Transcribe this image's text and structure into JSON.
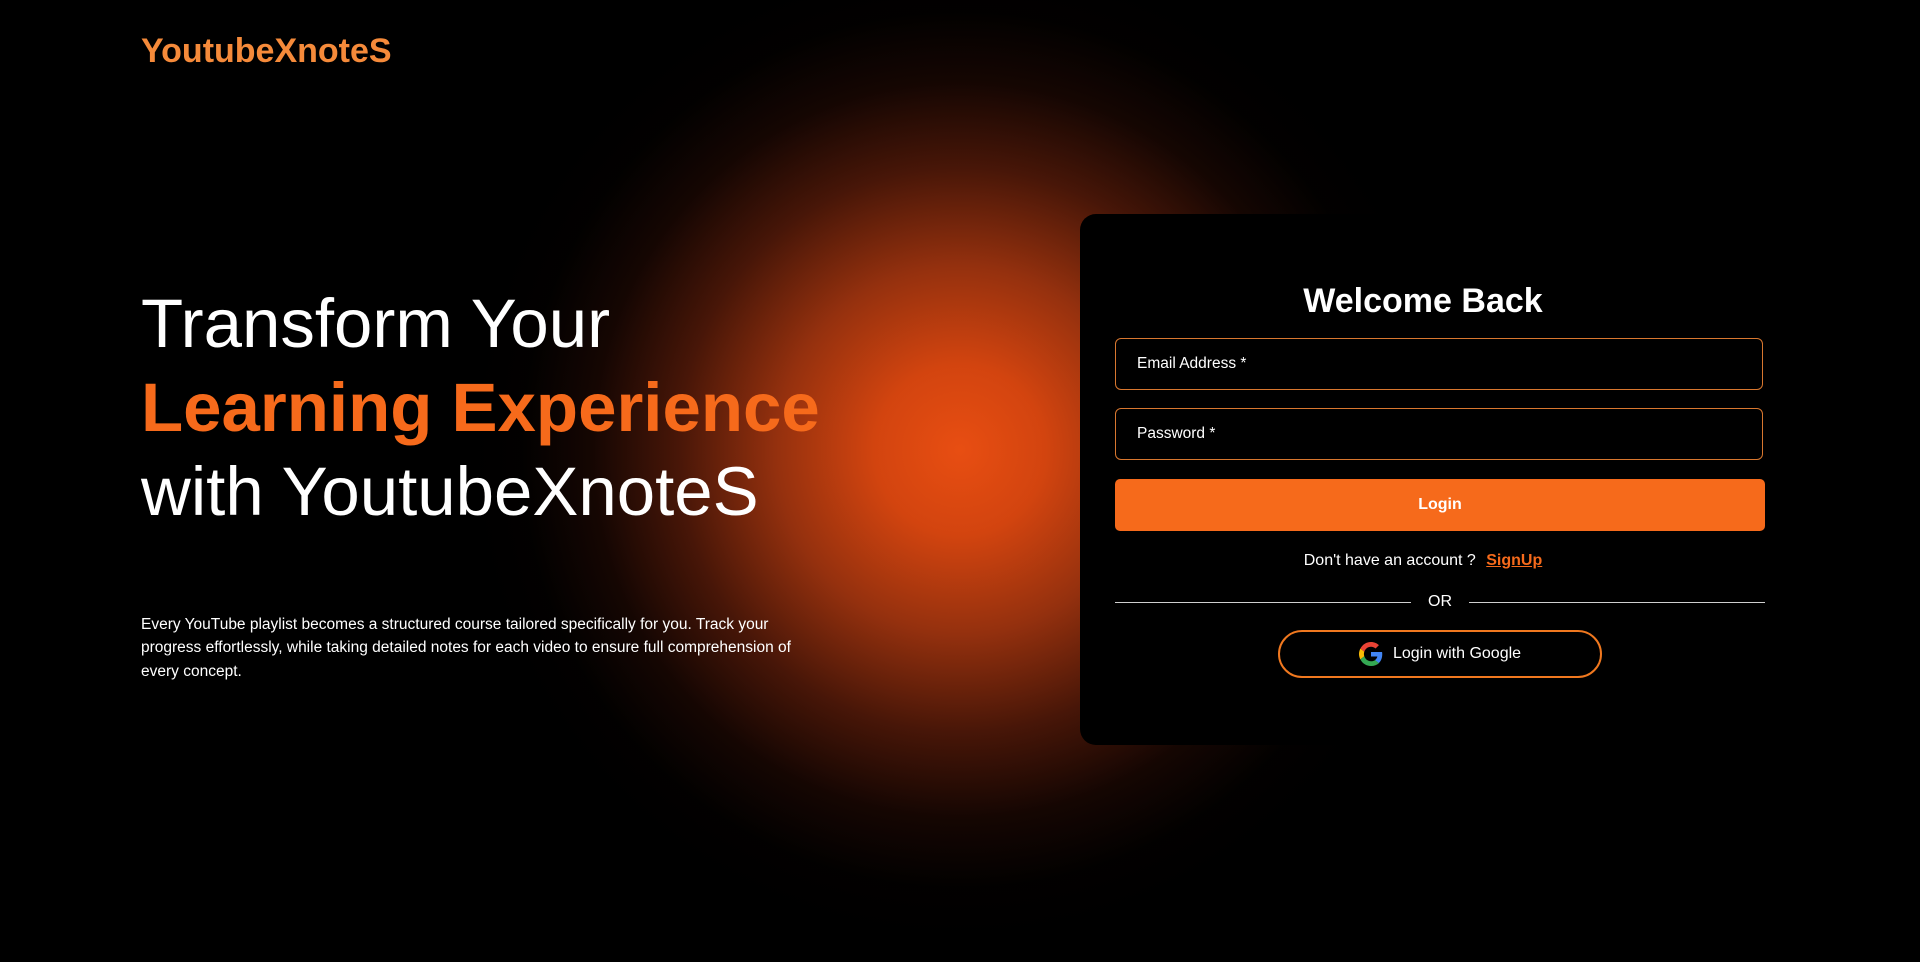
{
  "brand": {
    "name": "YoutubeXnoteS",
    "accent_color": "#f66a1b",
    "logo_color": "#f58a3a"
  },
  "hero": {
    "line1": "Transform Your",
    "line2": "Learning Experience",
    "line3": "with YoutubeXnoteS",
    "description": "Every YouTube playlist becomes a structured course tailored specifically for you. Track your progress effortlessly, while taking detailed notes for each video to ensure full comprehension of every concept."
  },
  "login_form": {
    "title": "Welcome Back",
    "email_placeholder": "Email Address *",
    "email_value": "",
    "password_placeholder": "Password *",
    "password_value": "",
    "login_label": "Login",
    "signup_prompt": "Don't have an account ?",
    "signup_link": "SignUp",
    "divider_text": "OR",
    "google_label": "Login with Google",
    "google_icon": "google-icon"
  }
}
